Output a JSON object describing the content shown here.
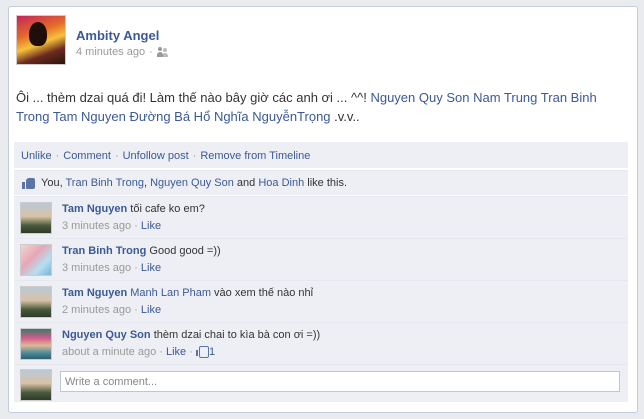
{
  "post": {
    "author": "Ambity Angel",
    "timestamp": "4 minutes ago",
    "text": "Ôi ... thèm dzai quá đi! Làm thế nào bây giờ các anh ơi ... ^^!",
    "mentions": [
      "Nguyen Quy Son",
      "Nam Trung",
      "Tran Binh Trong",
      "Tam Nguyen",
      "Đường Bá Hổ",
      "Nghĩa NguyễnTrọng"
    ],
    "suffix": ".v.v.."
  },
  "actions": {
    "unlike": "Unlike",
    "comment": "Comment",
    "unfollow": "Unfollow post",
    "remove": "Remove from Timeline"
  },
  "likes": {
    "you": "You,",
    "p1": "Tran Binh Trong",
    "sep1": ",",
    "p2": "Nguyen Quy Son",
    "and": "and",
    "p3": "Hoa Dinh",
    "tail": "like this."
  },
  "comments": [
    {
      "name": "Tam Nguyen",
      "tag": "",
      "text": "tối cafe ko em?",
      "time": "3 minutes ago",
      "like": "Like",
      "likes": ""
    },
    {
      "name": "Tran Binh Trong",
      "tag": "",
      "text": "Good good =))",
      "time": "3 minutes ago",
      "like": "Like",
      "likes": ""
    },
    {
      "name": "Tam Nguyen",
      "tag": "Manh Lan Pham",
      "text": "vào xem thế nào nhỉ",
      "time": "2 minutes ago",
      "like": "Like",
      "likes": ""
    },
    {
      "name": "Nguyen Quy Son",
      "tag": "",
      "text": "thèm dzai chai to kìa bà con ơi =))",
      "time": "about a minute ago",
      "like": "Like",
      "likes": "1"
    }
  ],
  "composer": {
    "placeholder": "Write a comment..."
  },
  "meta_sep": " · "
}
